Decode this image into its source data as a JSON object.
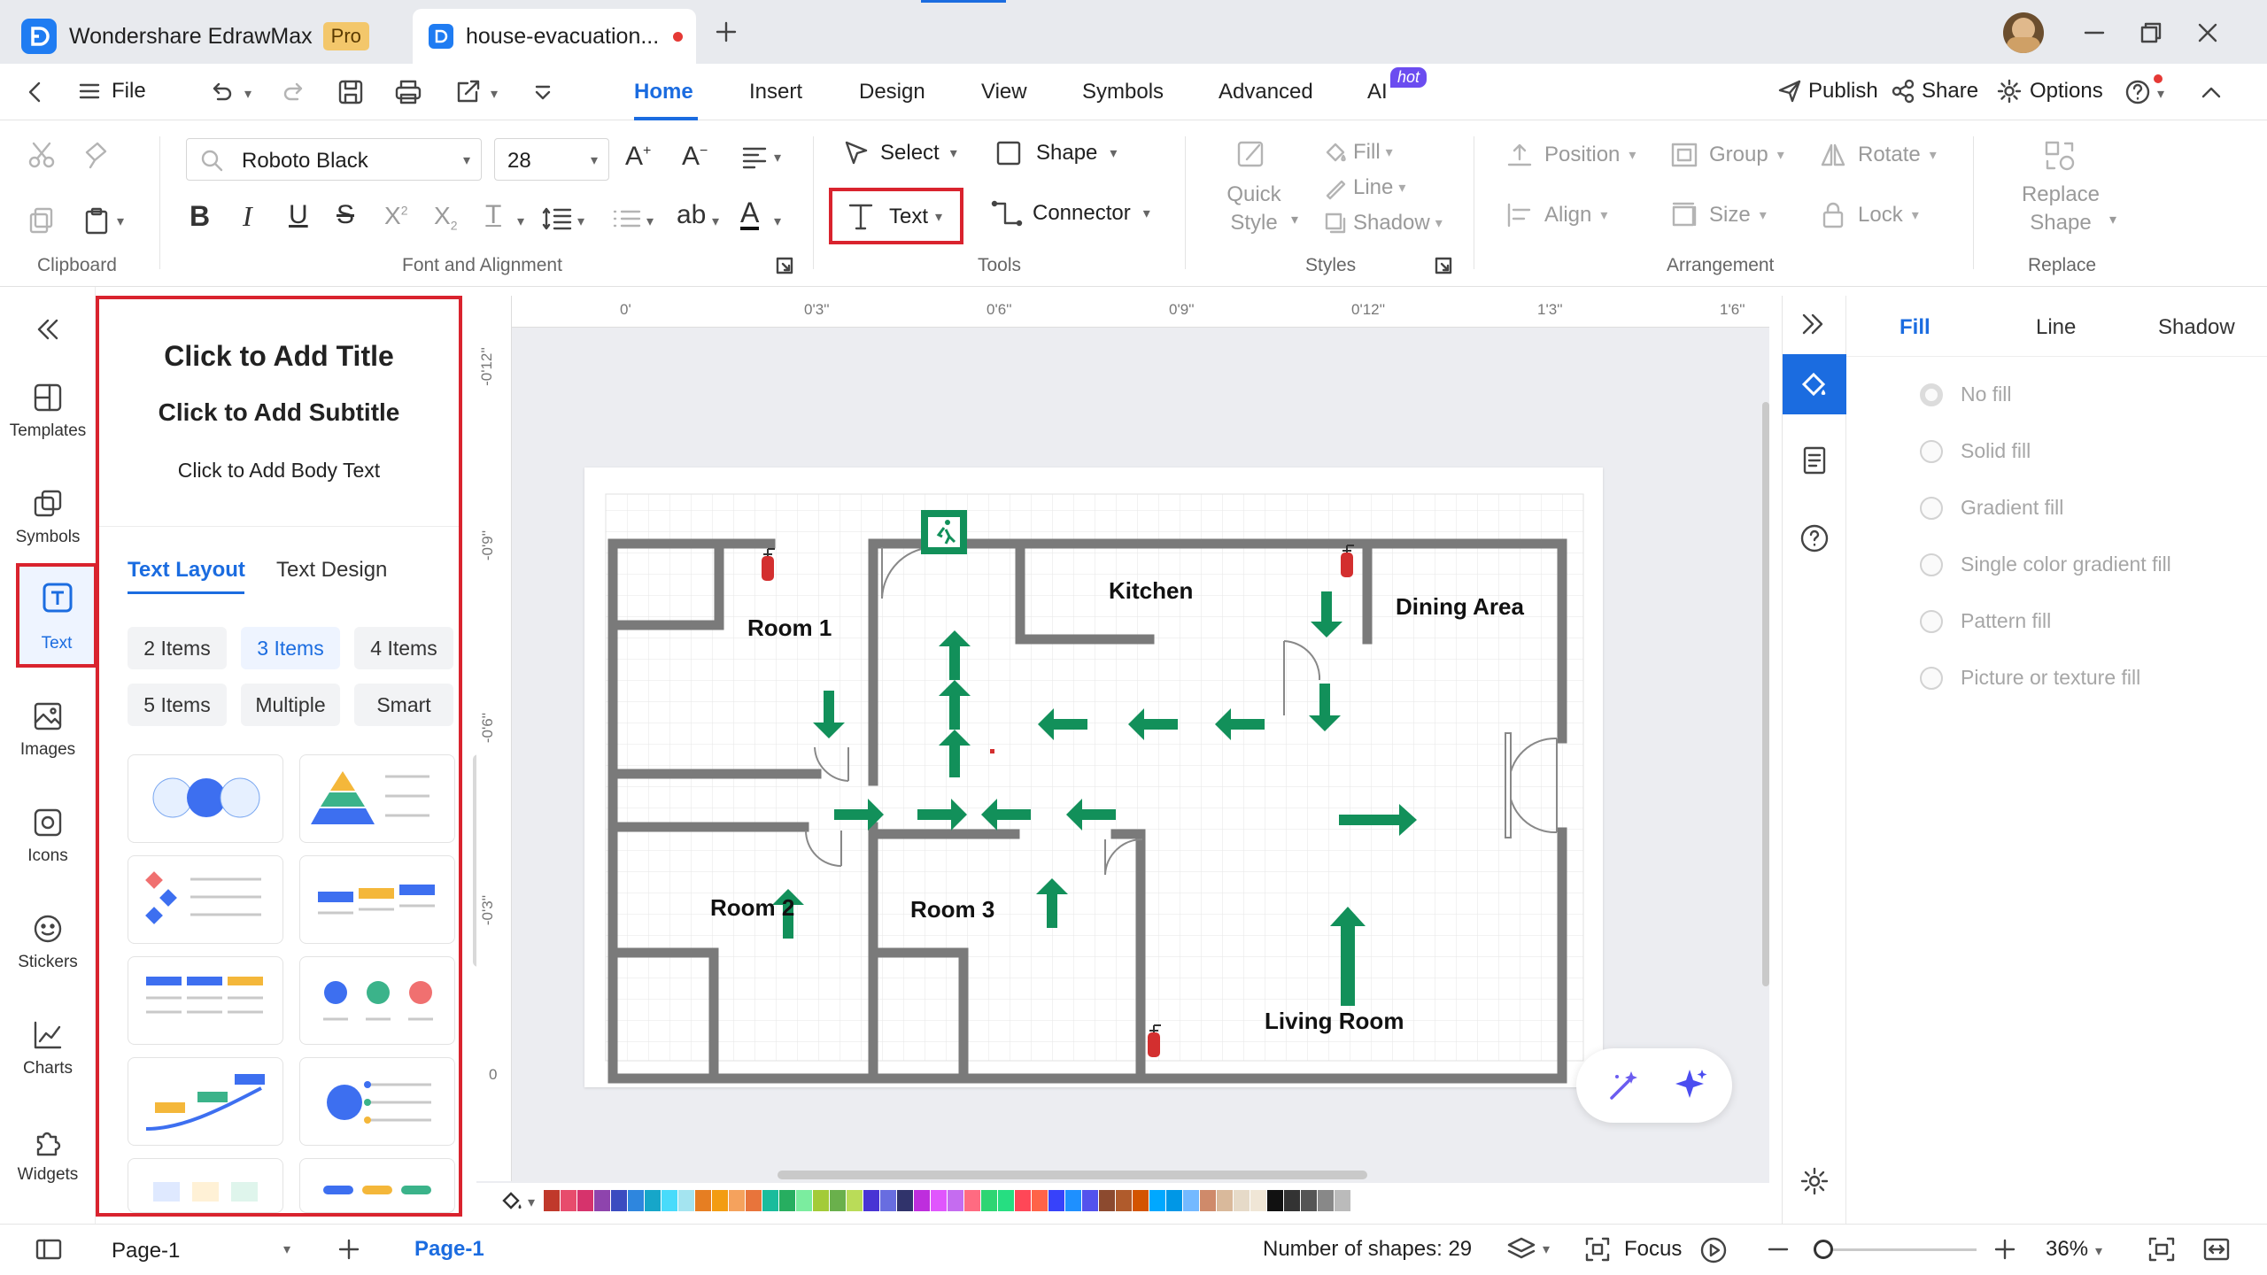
{
  "app": {
    "name": "Wondershare EdrawMax",
    "badge": "Pro"
  },
  "tab": {
    "title": "house-evacuation..."
  },
  "menubar": {
    "file": "File",
    "items": [
      "Home",
      "Insert",
      "Design",
      "View",
      "Symbols",
      "Advanced",
      "AI"
    ],
    "ai_badge": "hot",
    "publish": "Publish",
    "share": "Share",
    "options": "Options"
  },
  "ribbon": {
    "font": "Roboto Black",
    "font_size": "28",
    "select": "Select",
    "shape": "Shape",
    "text": "Text",
    "connector": "Connector",
    "quick_style": "Quick Style",
    "fill": "Fill",
    "line": "Line",
    "shadow": "Shadow",
    "position": "Position",
    "group": "Group",
    "rotate": "Rotate",
    "align": "Align",
    "size": "Size",
    "lock": "Lock",
    "replace_shape": "Replace Shape",
    "groups": [
      "Clipboard",
      "Font and Alignment",
      "Tools",
      "Styles",
      "Arrangement",
      "Replace"
    ]
  },
  "leftrail": [
    "Templates",
    "Symbols",
    "Text",
    "Images",
    "Icons",
    "Stickers",
    "Charts",
    "Widgets"
  ],
  "library": {
    "title": "Click to Add Title",
    "subtitle": "Click to Add Subtitle",
    "body": "Click to Add Body Text",
    "tabs": [
      "Text Layout",
      "Text Design"
    ],
    "chips": [
      "2 Items",
      "3 Items",
      "4 Items",
      "5 Items",
      "Multiple",
      "Smart"
    ]
  },
  "ruler": {
    "top": [
      "0'",
      "0'3''",
      "0'6''",
      "0'9''",
      "0'12''",
      "1'3''",
      "1'6''"
    ],
    "left": [
      "-0'12''",
      "-0'9''",
      "-0'6''",
      "-0'3''",
      "0"
    ]
  },
  "diagram": {
    "rooms": [
      "Room 1",
      "Kitchen",
      "Dining Area",
      "Room 2",
      "Room 3",
      "Living Room"
    ]
  },
  "rightpanel": {
    "tabs": [
      "Fill",
      "Line",
      "Shadow"
    ],
    "options": [
      "No fill",
      "Solid fill",
      "Gradient fill",
      "Single color gradient fill",
      "Pattern fill",
      "Picture or texture fill"
    ]
  },
  "status": {
    "page_dropdown": "Page-1",
    "page_tab": "Page-1",
    "shapes": "Number of shapes: 29",
    "focus": "Focus",
    "zoom": "36%"
  },
  "colors": {
    "accent": "#1b6ce0",
    "highlight": "#d9232e",
    "arrow": "#12905a",
    "wall": "#7a7a7a"
  }
}
